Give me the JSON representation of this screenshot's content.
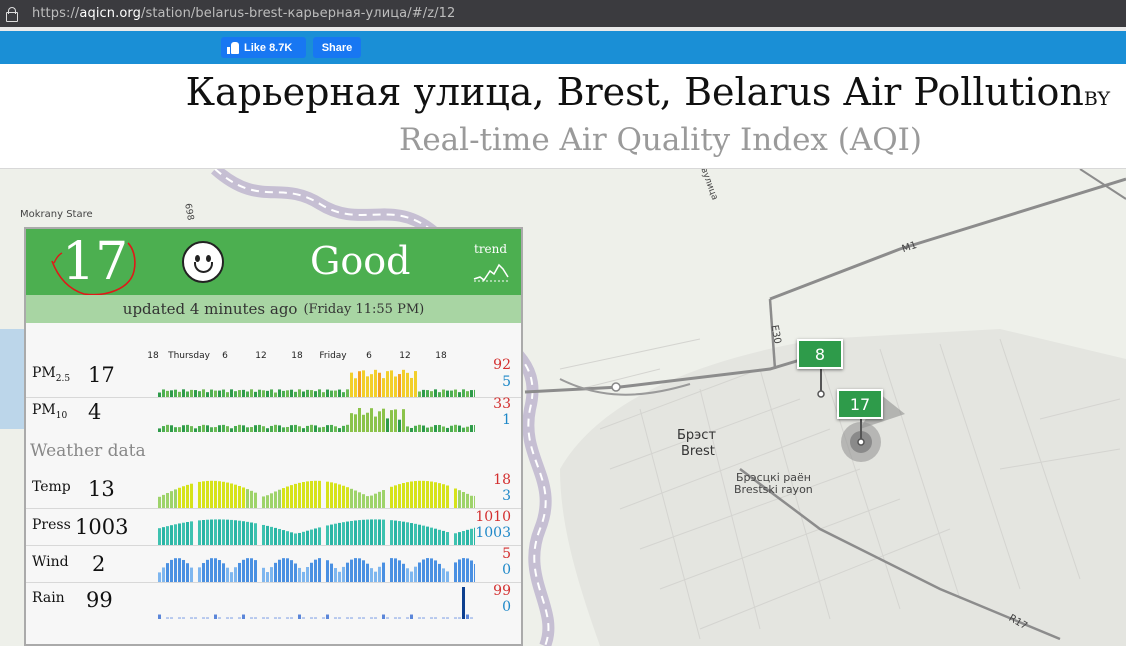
{
  "browser": {
    "url_prefix": "https://",
    "url_host": "aqicn.org",
    "url_path": "/station/belarus-brest-карьерная-улица/#/z/12"
  },
  "social": {
    "like_label": "Like 8.7K",
    "share_label": "Share"
  },
  "header": {
    "title": "Карьерная улица, Brest, Belarus Air Pollution",
    "country_code": "BY",
    "subtitle": "Real-time Air Quality Index (AQI)"
  },
  "map": {
    "labels": {
      "mokrany": "Mokrany Stare",
      "brest_cyr": "Брэст",
      "brest_lat": "Brest",
      "rayon_cyr": "Брэсцкі раён",
      "rayon_lat": "Brestski rayon",
      "m1": "M1",
      "e30": "E30",
      "r17": "R17",
      "road_698": "698",
      "street": "вулица"
    },
    "markers": [
      {
        "value": "8"
      },
      {
        "value": "17"
      }
    ]
  },
  "widget": {
    "aqi": "17",
    "level": "Good",
    "trend_label": "trend",
    "updated": "updated 4 minutes ago",
    "updated_time": "(Friday 11:55 PM)",
    "ticks": [
      "18",
      "Thursday",
      "6",
      "12",
      "18",
      "Friday",
      "6",
      "12",
      "18"
    ],
    "weather_title": "Weather data",
    "rows": {
      "pm25": {
        "name": "PM",
        "sub": "2.5",
        "value": "17",
        "max": "92",
        "min": "5"
      },
      "pm10": {
        "name": "PM",
        "sub": "10",
        "value": "4",
        "max": "33",
        "min": "1"
      },
      "temp": {
        "name": "Temp",
        "value": "13",
        "max": "18",
        "min": "3"
      },
      "press": {
        "name": "Press",
        "value": "1003",
        "max": "1010",
        "min": "1003"
      },
      "wind": {
        "name": "Wind",
        "value": "2",
        "max": "5",
        "min": "0"
      },
      "rain": {
        "name": "Rain",
        "value": "99",
        "max": "99",
        "min": "0"
      }
    }
  },
  "colors": {
    "good_green": "#4caf50",
    "max_red": "#d32f2f",
    "min_blue": "#1e88c8",
    "marker_green": "#2e9b4a"
  }
}
